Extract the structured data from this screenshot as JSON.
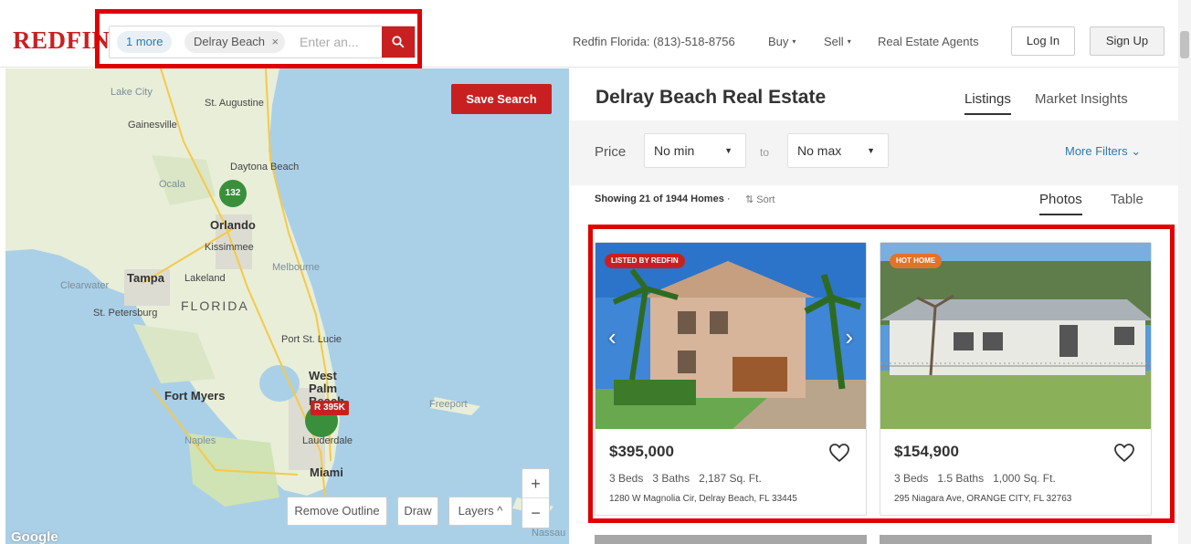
{
  "header": {
    "logo": "REDFIN",
    "search": {
      "more_chip": "1 more",
      "location_chip": "Delray Beach",
      "placeholder": "Enter an...",
      "remove_icon": "close-icon",
      "button_icon": "search-icon"
    },
    "phone": "Redfin Florida: (813)-518-8756",
    "nav": [
      {
        "label": "Buy",
        "caret": "▾"
      },
      {
        "label": "Sell",
        "caret": "▾"
      },
      {
        "label": "Real Estate Agents"
      }
    ],
    "login_label": "Log In",
    "signup_label": "Sign Up"
  },
  "map": {
    "save_search_label": "Save Search",
    "labels": {
      "lake_city": "Lake City",
      "st_augustine": "St. Augustine",
      "gainesville": "Gainesville",
      "daytona": "Daytona Beach",
      "ocala": "Ocala",
      "orlando": "Orlando",
      "kissimmee": "Kissimmee",
      "tampa": "Tampa",
      "lakeland": "Lakeland",
      "melbourne": "Melbourne",
      "clearwater": "Clearwater",
      "florida": "FLORIDA",
      "st_petersburg": "St. Petersburg",
      "port_st_lucie": "Port St. Lucie",
      "west_palm_beach": "West Palm Beach",
      "fort_myers": "Fort Myers",
      "freeport": "Freeport",
      "naples": "Naples",
      "lauderdale": "Lauderdale",
      "miami": "Miami",
      "nassau": "Nassau",
      "google": "Google"
    },
    "cluster_count": "132",
    "price_pin": "395K",
    "buttons": {
      "remove_outline": "Remove Outline",
      "draw": "Draw",
      "layers": "Layers ^"
    },
    "zoom_in": "+",
    "zoom_out": "−"
  },
  "panel": {
    "title": "Delray Beach Real Estate",
    "tabs": [
      "Listings",
      "Market Insights"
    ],
    "active_tab": "Listings",
    "filters": {
      "price_label": "Price",
      "min": "No min",
      "to": "to",
      "max": "No max",
      "more_filters": "More Filters ⌄"
    },
    "showing_prefix": "Showing 21 of 1944 Homes",
    "sort_label": "⇅ Sort",
    "view_tabs": [
      "Photos",
      "Table"
    ],
    "active_view": "Photos"
  },
  "listings": [
    {
      "badge": "LISTED BY REDFIN",
      "price": "$395,000",
      "beds": "3 Beds",
      "baths": "3 Baths",
      "sqft": "2,187 Sq. Ft.",
      "address": "1280 W Magnolia Cir, Delray Beach, FL 33445"
    },
    {
      "badge": "HOT HOME",
      "price": "$154,900",
      "beds": "3 Beds",
      "baths": "1.5 Baths",
      "sqft": "1,000 Sq. Ft.",
      "address": "295 Niagara Ave, ORANGE CITY, FL 32763"
    }
  ],
  "colors": {
    "brand": "#c82021",
    "link": "#2d7ab3",
    "highlight": "#e00000",
    "map_water": "#aad0e8",
    "map_land": "#e9eed8"
  }
}
